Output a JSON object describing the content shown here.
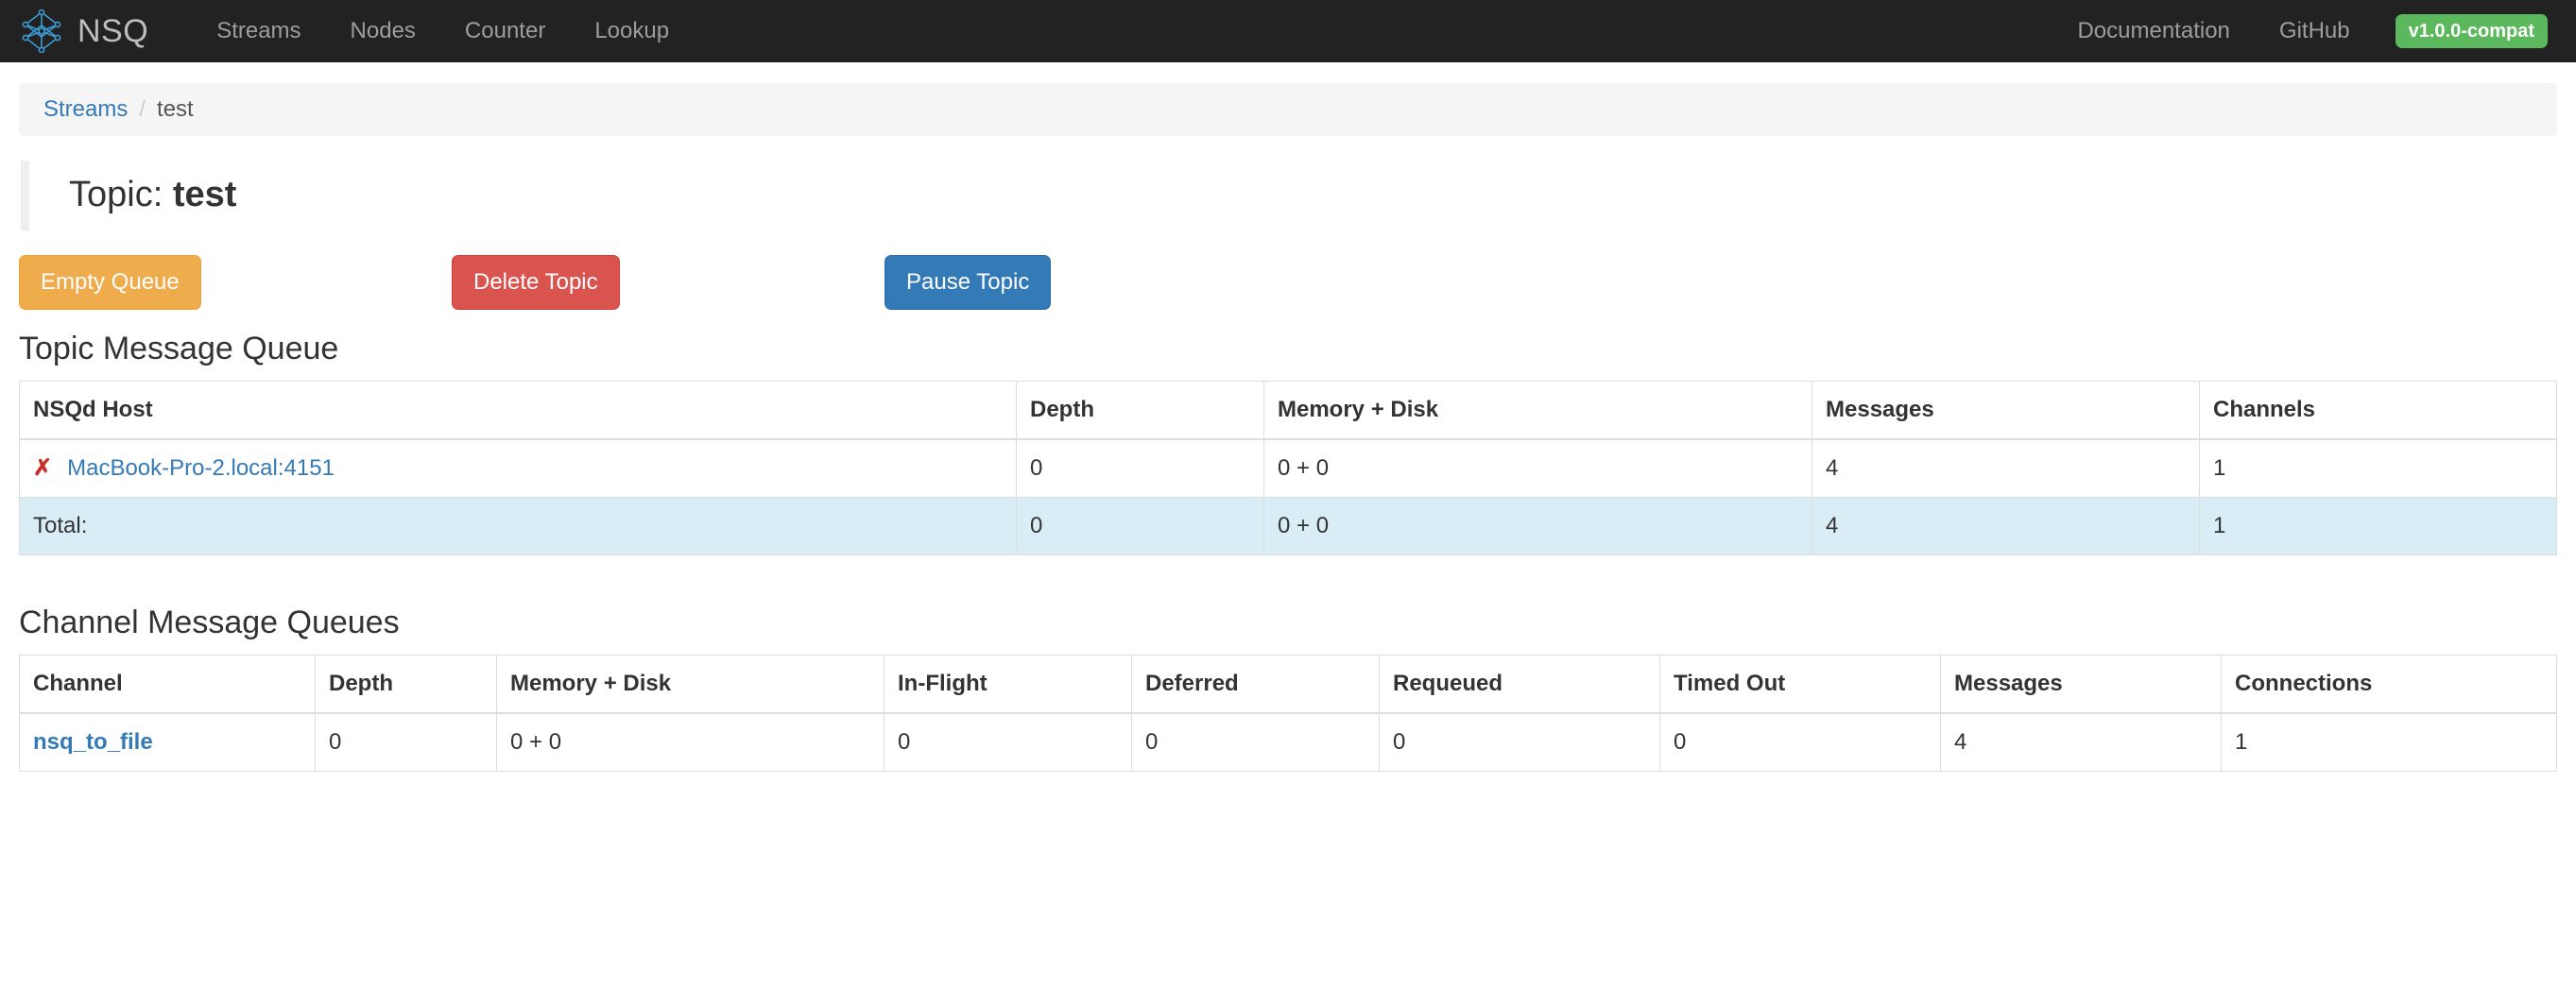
{
  "navbar": {
    "brand": "NSQ",
    "logo_icon": "nsq-diamond-logo-icon",
    "links": [
      {
        "label": "Streams"
      },
      {
        "label": "Nodes"
      },
      {
        "label": "Counter"
      },
      {
        "label": "Lookup"
      }
    ],
    "right_links": [
      {
        "label": "Documentation"
      },
      {
        "label": "GitHub"
      }
    ],
    "version_badge": "v1.0.0-compat",
    "colors": {
      "background": "#222222",
      "link": "#9d9d9d",
      "brand": "#bdbdbd",
      "badge": "#5cb85c"
    }
  },
  "breadcrumb": {
    "root": "Streams",
    "separator": "/",
    "current": "test"
  },
  "page": {
    "title_prefix": "Topic:",
    "title_value": "test"
  },
  "actions": {
    "empty_queue": "Empty Queue",
    "delete_topic": "Delete Topic",
    "pause_topic": "Pause Topic",
    "colors": {
      "warning": "#eeac4d",
      "danger": "#d9534f",
      "primary": "#337ab7"
    }
  },
  "topic_queue": {
    "heading": "Topic Message Queue",
    "columns": [
      "NSQd Host",
      "Depth",
      "Memory + Disk",
      "Messages",
      "Channels"
    ],
    "rows": [
      {
        "status_icon": "cross-icon",
        "host": "MacBook-Pro-2.local:4151",
        "depth": "0",
        "memory_disk": "0 + 0",
        "messages": "4",
        "channels": "1"
      }
    ],
    "total": {
      "label": "Total:",
      "depth": "0",
      "memory_disk": "0 + 0",
      "messages": "4",
      "channels": "1"
    }
  },
  "channel_queues": {
    "heading": "Channel Message Queues",
    "columns": [
      "Channel",
      "Depth",
      "Memory + Disk",
      "In-Flight",
      "Deferred",
      "Requeued",
      "Timed Out",
      "Messages",
      "Connections"
    ],
    "rows": [
      {
        "channel": "nsq_to_file",
        "depth": "0",
        "memory_disk": "0 + 0",
        "in_flight": "0",
        "deferred": "0",
        "requeued": "0",
        "timed_out": "0",
        "messages": "4",
        "connections": "1"
      }
    ]
  }
}
